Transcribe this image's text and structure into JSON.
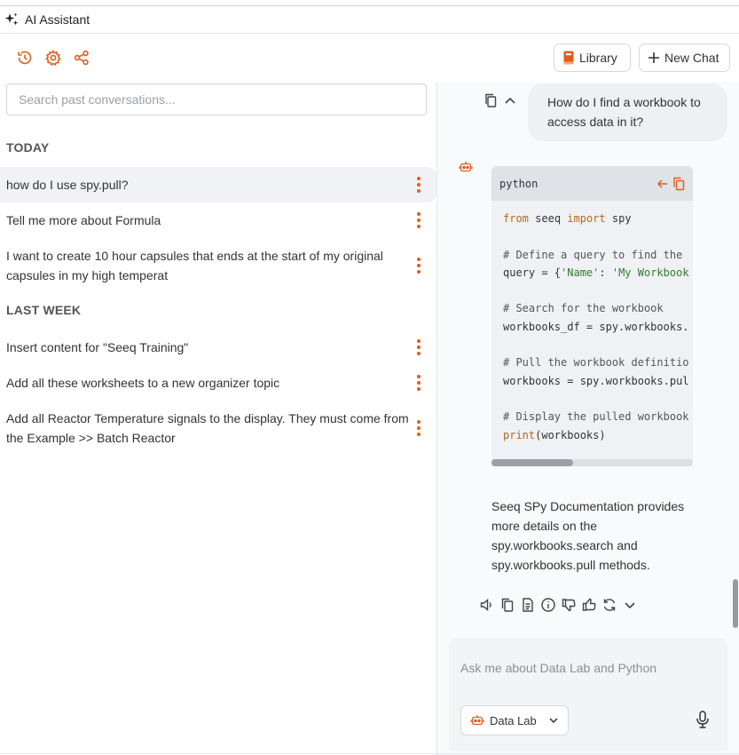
{
  "window": {
    "title": "AI Assistant"
  },
  "toolbar": {
    "library_label": "Library",
    "new_chat_label": "New Chat"
  },
  "search": {
    "placeholder": "Search past conversations..."
  },
  "sections": [
    {
      "heading": "TODAY",
      "items": [
        {
          "label": "how do I use spy.pull?"
        },
        {
          "label": "Tell me more about Formula"
        },
        {
          "label": "I want to create 10 hour capsules that ends at the start of my original capsules in my high temperat"
        }
      ]
    },
    {
      "heading": "LAST WEEK",
      "items": [
        {
          "label": "Insert content for \"Seeq Training\""
        },
        {
          "label": "Add all these worksheets to a new organizer topic"
        },
        {
          "label": "Add all Reactor Temperature signals to the display. They must come from the Example >> Batch Reactor"
        }
      ]
    }
  ],
  "chat": {
    "user_message": "How do I find a workbook to access data in it?",
    "code": {
      "language": "python",
      "lines": [
        "from seeq import spy",
        "",
        "# Define a query to find the",
        "query = {'Name': 'My Workbook",
        "",
        "# Search for the workbook",
        "workbooks_df = spy.workbooks.",
        "",
        "# Pull the workbook definitio",
        "workbooks = spy.workbooks.pul",
        "",
        "# Display the pulled workbook",
        "print(workbooks)"
      ]
    },
    "answer": "Seeq SPy Documentation provides more details on the spy.workbooks.search and spy.workbooks.pull methods."
  },
  "composer": {
    "placeholder": "Ask me about Data Lab and Python",
    "mode_label": "Data Lab"
  },
  "colors": {
    "accent": "#e25c1c",
    "panel_bg": "#f9fafb",
    "active_row": "#f0f2f5"
  },
  "icons": [
    "sparkle-icon",
    "history-icon",
    "gear-icon",
    "share-icon",
    "book-icon",
    "plus-icon",
    "copy-icon",
    "chevron-up-icon",
    "robot-icon",
    "arrow-left-icon",
    "speaker-icon",
    "document-icon",
    "info-icon",
    "thumbs-down-icon",
    "thumbs-up-icon",
    "refresh-icon",
    "chevron-down-icon",
    "microphone-icon"
  ]
}
